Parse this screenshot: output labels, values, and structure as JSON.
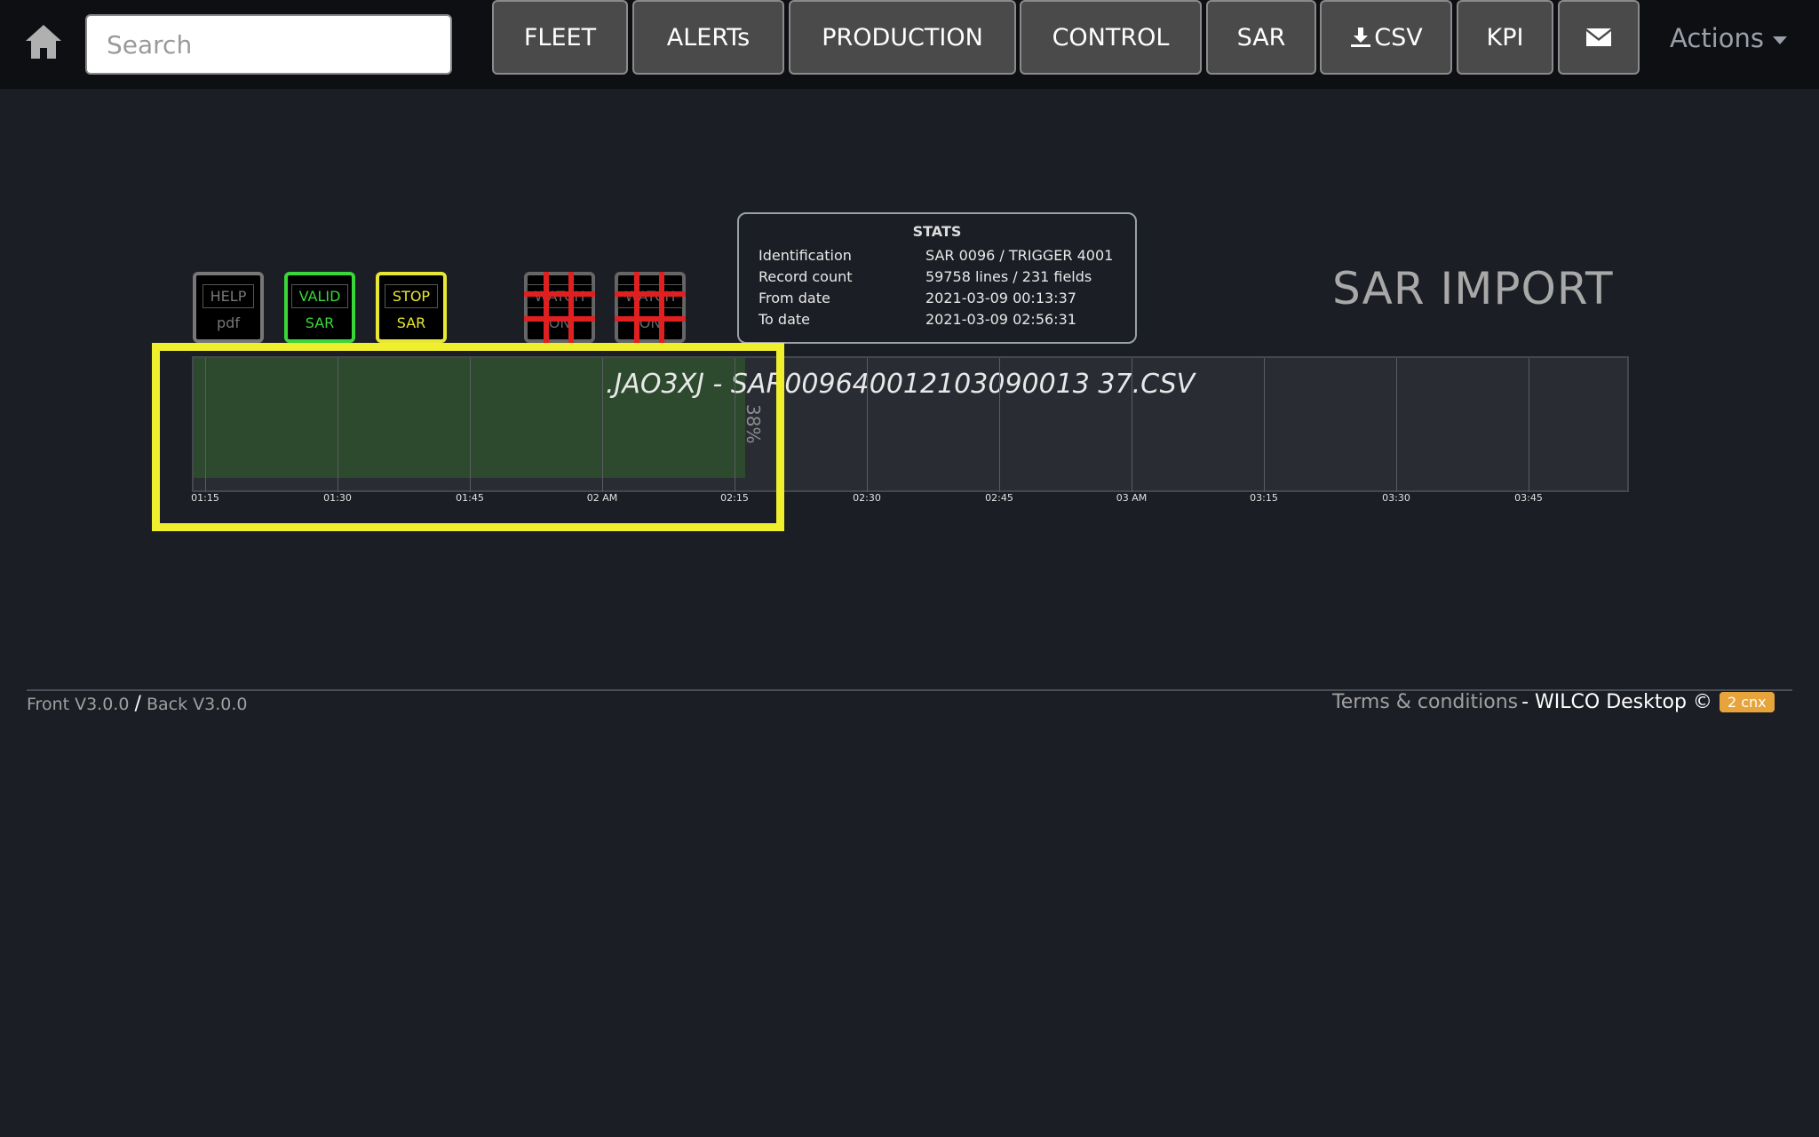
{
  "nav": {
    "search_placeholder": "Search",
    "buttons": [
      "FLEET",
      "ALERTs",
      "PRODUCTION",
      "CONTROL",
      "SAR",
      "CSV",
      "KPI"
    ],
    "actions_label": "Actions"
  },
  "tools": {
    "help": {
      "top": "HELP",
      "bottom": "pdf"
    },
    "valid": {
      "top": "VALID",
      "bottom": "SAR"
    },
    "stop": {
      "top": "STOP",
      "bottom": "SAR"
    },
    "watch": {
      "top": "WATCH",
      "bottom": "ON"
    }
  },
  "stats": {
    "title": "STATS",
    "rows": [
      {
        "label": "Identification",
        "value": "SAR 0096 / TRIGGER 4001"
      },
      {
        "label": "Record count",
        "value": "59758 lines / 231 fields"
      },
      {
        "label": "From date",
        "value": "2021-03-09 00:13:37"
      },
      {
        "label": "To date",
        "value": "2021-03-09 02:56:31"
      }
    ]
  },
  "page_title": "SAR IMPORT",
  "timeline": {
    "file_label": ".JAO3XJ - SAR009640012103090013 37.CSV",
    "progress_percent": 38,
    "progress_label": "38%",
    "ticks": [
      "01:15",
      "01:30",
      "01:45",
      "02 AM",
      "02:15",
      "02:30",
      "02:45",
      "03 AM",
      "03:15",
      "03:30",
      "03:45"
    ]
  },
  "footer": {
    "front": "Front V3.0.0",
    "separator": "/",
    "back": "Back V3.0.0",
    "terms": "Terms & conditions",
    "brand": "- WILCO Desktop ©",
    "badge": "2 cnx"
  },
  "colors": {
    "background": "#1c1e26",
    "valid": "#39d739",
    "stop": "#e8e834",
    "highlight": "#f0ef2e",
    "badge": "#e7a43a"
  }
}
